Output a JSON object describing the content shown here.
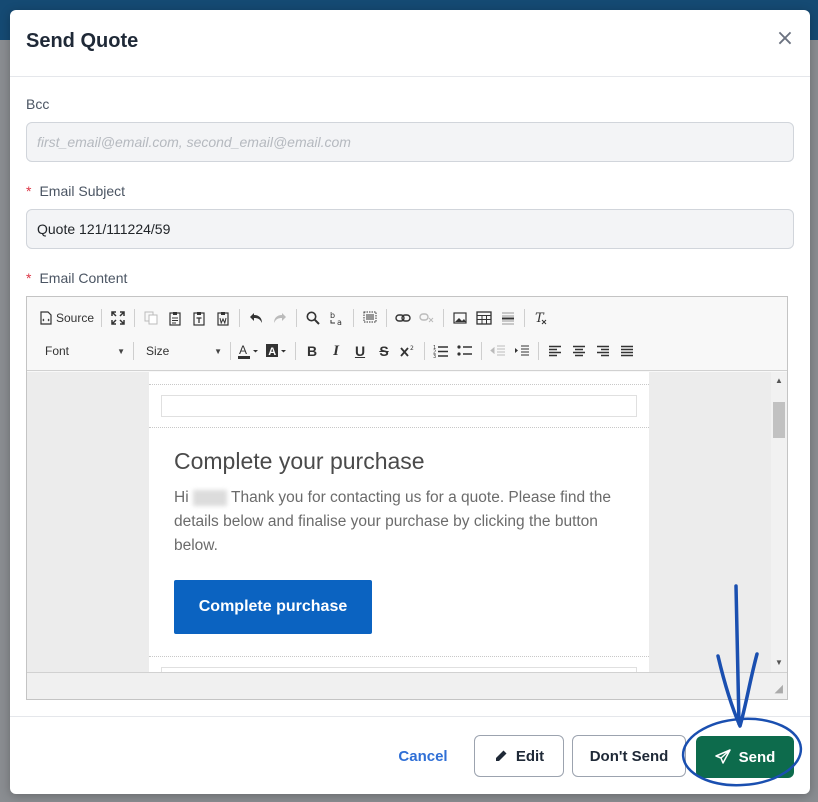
{
  "modal": {
    "title": "Send Quote",
    "close_glyph": "×"
  },
  "form": {
    "bcc_label": "Bcc",
    "bcc_placeholder": "first_email@email.com, second_email@email.com",
    "subject_label": "Email Subject",
    "subject_value": "Quote 121/111224/59",
    "content_label": "Email Content",
    "required_marker": "*"
  },
  "toolbar": {
    "source_label": "Source",
    "font_label": "Font",
    "size_label": "Size"
  },
  "email": {
    "heading": "Complete your purchase",
    "greeting": "Hi",
    "body": "Thank you for contacting us for a quote. Please find the details below and finalise your purchase by clicking the button below.",
    "cta_label": "Complete purchase"
  },
  "footer": {
    "cancel_label": "Cancel",
    "edit_label": "Edit",
    "dont_send_label": "Don't Send",
    "send_label": "Send"
  },
  "colors": {
    "send_button": "#0d6b4c",
    "cta_button": "#0b63c1",
    "annotation": "#1a4fb0",
    "link": "#2f6fd6",
    "required": "#dc3545"
  }
}
